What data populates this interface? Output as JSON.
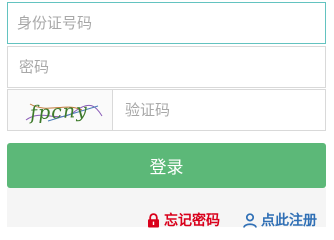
{
  "form": {
    "id_placeholder": "身份证号码",
    "password_placeholder": "密码",
    "captcha_placeholder": "验证码",
    "captcha_image_text": "fpcny",
    "login_label": "登录"
  },
  "links": {
    "forgot_password": {
      "label": "忘记密码",
      "icon": "lock-icon",
      "color": "#d9001b"
    },
    "register": {
      "label": "点此注册",
      "icon": "user-icon",
      "color": "#2f6fb5"
    }
  },
  "colors": {
    "accent_green": "#5cb878",
    "focus_border": "#63c3c0"
  }
}
